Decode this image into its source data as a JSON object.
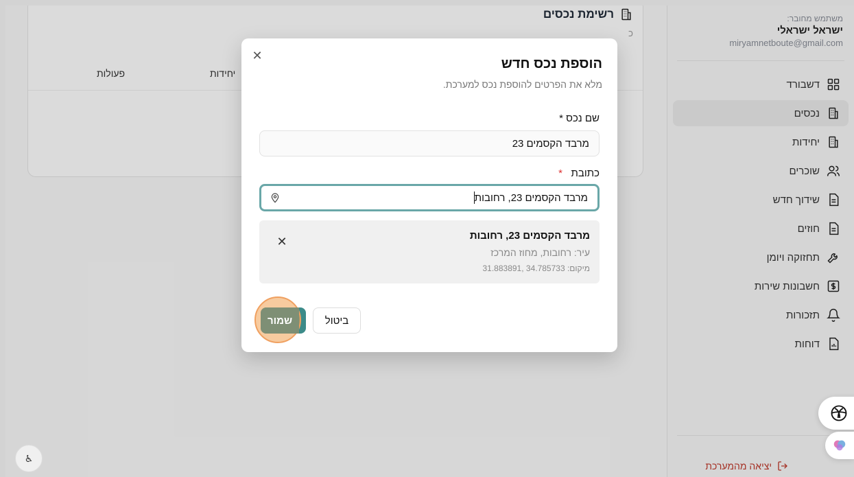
{
  "user": {
    "caption": "משתמש מחובר:",
    "name": "ישראל ישראלי",
    "email": "miryamnetboute@gmail.com"
  },
  "nav": {
    "items": [
      {
        "label": "דשבורד",
        "icon": "dashboard-icon"
      },
      {
        "label": "נכסים",
        "icon": "building-icon",
        "active": true
      },
      {
        "label": "יחידות",
        "icon": "building-icon"
      },
      {
        "label": "שוכרים",
        "icon": "users-icon"
      },
      {
        "label": "שידוך חדש",
        "icon": "document-icon"
      },
      {
        "label": "חוזים",
        "icon": "document-icon"
      },
      {
        "label": "תחזוקה ויומן",
        "icon": "wrench-icon"
      },
      {
        "label": "חשבונות שירות",
        "icon": "bill-icon"
      },
      {
        "label": "תזכורות",
        "icon": "bell-icon"
      },
      {
        "label": "דוחות",
        "icon": "report-icon"
      }
    ],
    "logout": "יציאה מהמערכת"
  },
  "main": {
    "title": "רשימת נכסים",
    "subtitle_fragment": "כ",
    "columns": [
      "פעולות",
      "יחידות"
    ]
  },
  "modal": {
    "title": "הוספת נכס חדש",
    "description": "מלא את הפרטים להוספת נכס למערכת.",
    "name_label": "שם נכס *",
    "name_value": "מרבד הקסמים 23",
    "address_label": "כתובת",
    "address_required": "*",
    "address_value": "מרבד הקסמים 23, רחובות",
    "place": {
      "name": "מרבד הקסמים 23, רחובות",
      "city": "עיר: רחובות, מחוז המרכז",
      "location": "מיקום: 34.785733 ,31.883891"
    },
    "cancel_label": "ביטול",
    "save_label": "שמור"
  },
  "colors": {
    "accent": "#3c8b89",
    "focus_ring": "#6aa7a8",
    "logout": "#c0392b",
    "highlight": "#f0a060"
  }
}
